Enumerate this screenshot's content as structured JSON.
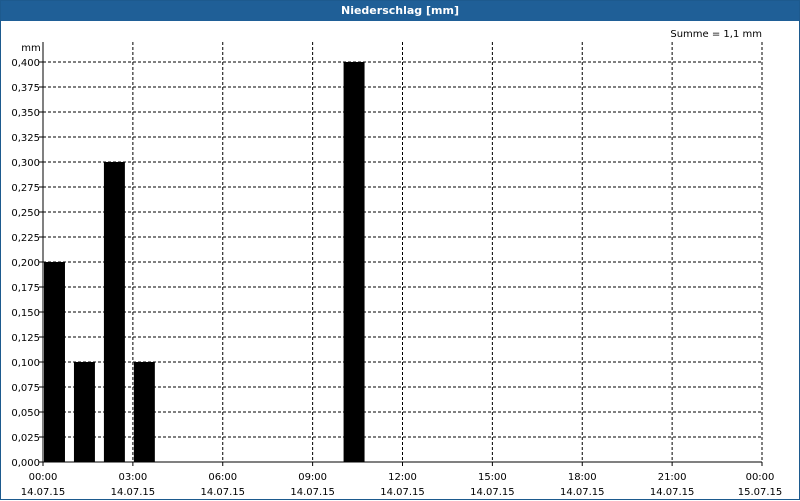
{
  "window": {
    "title": "Niederschlag [mm]"
  },
  "chart_data": {
    "type": "bar",
    "title": "Niederschlag [mm]",
    "ylabel": "mm",
    "annotation": "Summe = 1,1 mm",
    "ylim": [
      0,
      0.4
    ],
    "yticks": [
      "0,000",
      "0,025",
      "0,050",
      "0,075",
      "0,100",
      "0,125",
      "0,150",
      "0,175",
      "0,200",
      "0,225",
      "0,250",
      "0,275",
      "0,300",
      "0,325",
      "0,350",
      "0,375",
      "0,400"
    ],
    "xlim_hours": [
      0,
      24
    ],
    "xticks": [
      {
        "time": "00:00",
        "date": "14.07.15"
      },
      {
        "time": "03:00",
        "date": "14.07.15"
      },
      {
        "time": "06:00",
        "date": "14.07.15"
      },
      {
        "time": "09:00",
        "date": "14.07.15"
      },
      {
        "time": "12:00",
        "date": "14.07.15"
      },
      {
        "time": "15:00",
        "date": "14.07.15"
      },
      {
        "time": "18:00",
        "date": "14.07.15"
      },
      {
        "time": "21:00",
        "date": "14.07.15"
      },
      {
        "time": "00:00",
        "date": "15.07.15"
      }
    ],
    "bars": [
      {
        "hour": 0,
        "value": 0.2
      },
      {
        "hour": 1,
        "value": 0.1
      },
      {
        "hour": 2,
        "value": 0.3
      },
      {
        "hour": 3,
        "value": 0.1
      },
      {
        "hour": 10,
        "value": 0.4
      }
    ],
    "grid": true,
    "bar_color": "#000000"
  }
}
